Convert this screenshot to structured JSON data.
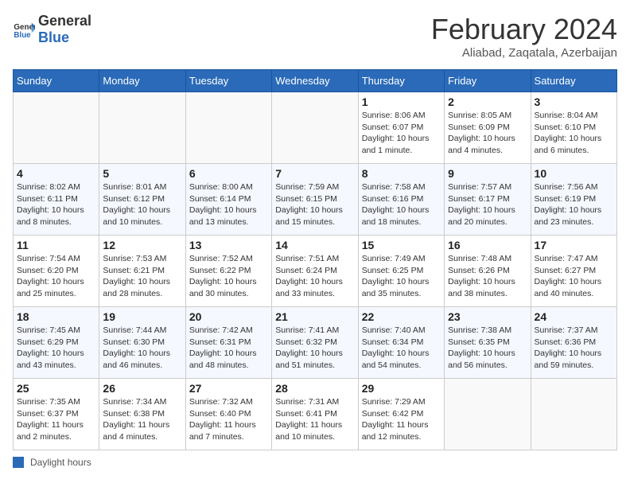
{
  "header": {
    "logo_general": "General",
    "logo_blue": "Blue",
    "month_year": "February 2024",
    "location": "Aliabad, Zaqatala, Azerbaijan"
  },
  "days_of_week": [
    "Sunday",
    "Monday",
    "Tuesday",
    "Wednesday",
    "Thursday",
    "Friday",
    "Saturday"
  ],
  "weeks": [
    [
      {
        "day": "",
        "info": ""
      },
      {
        "day": "",
        "info": ""
      },
      {
        "day": "",
        "info": ""
      },
      {
        "day": "",
        "info": ""
      },
      {
        "day": "1",
        "info": "Sunrise: 8:06 AM\nSunset: 6:07 PM\nDaylight: 10 hours and 1 minute."
      },
      {
        "day": "2",
        "info": "Sunrise: 8:05 AM\nSunset: 6:09 PM\nDaylight: 10 hours and 4 minutes."
      },
      {
        "day": "3",
        "info": "Sunrise: 8:04 AM\nSunset: 6:10 PM\nDaylight: 10 hours and 6 minutes."
      }
    ],
    [
      {
        "day": "4",
        "info": "Sunrise: 8:02 AM\nSunset: 6:11 PM\nDaylight: 10 hours and 8 minutes."
      },
      {
        "day": "5",
        "info": "Sunrise: 8:01 AM\nSunset: 6:12 PM\nDaylight: 10 hours and 10 minutes."
      },
      {
        "day": "6",
        "info": "Sunrise: 8:00 AM\nSunset: 6:14 PM\nDaylight: 10 hours and 13 minutes."
      },
      {
        "day": "7",
        "info": "Sunrise: 7:59 AM\nSunset: 6:15 PM\nDaylight: 10 hours and 15 minutes."
      },
      {
        "day": "8",
        "info": "Sunrise: 7:58 AM\nSunset: 6:16 PM\nDaylight: 10 hours and 18 minutes."
      },
      {
        "day": "9",
        "info": "Sunrise: 7:57 AM\nSunset: 6:17 PM\nDaylight: 10 hours and 20 minutes."
      },
      {
        "day": "10",
        "info": "Sunrise: 7:56 AM\nSunset: 6:19 PM\nDaylight: 10 hours and 23 minutes."
      }
    ],
    [
      {
        "day": "11",
        "info": "Sunrise: 7:54 AM\nSunset: 6:20 PM\nDaylight: 10 hours and 25 minutes."
      },
      {
        "day": "12",
        "info": "Sunrise: 7:53 AM\nSunset: 6:21 PM\nDaylight: 10 hours and 28 minutes."
      },
      {
        "day": "13",
        "info": "Sunrise: 7:52 AM\nSunset: 6:22 PM\nDaylight: 10 hours and 30 minutes."
      },
      {
        "day": "14",
        "info": "Sunrise: 7:51 AM\nSunset: 6:24 PM\nDaylight: 10 hours and 33 minutes."
      },
      {
        "day": "15",
        "info": "Sunrise: 7:49 AM\nSunset: 6:25 PM\nDaylight: 10 hours and 35 minutes."
      },
      {
        "day": "16",
        "info": "Sunrise: 7:48 AM\nSunset: 6:26 PM\nDaylight: 10 hours and 38 minutes."
      },
      {
        "day": "17",
        "info": "Sunrise: 7:47 AM\nSunset: 6:27 PM\nDaylight: 10 hours and 40 minutes."
      }
    ],
    [
      {
        "day": "18",
        "info": "Sunrise: 7:45 AM\nSunset: 6:29 PM\nDaylight: 10 hours and 43 minutes."
      },
      {
        "day": "19",
        "info": "Sunrise: 7:44 AM\nSunset: 6:30 PM\nDaylight: 10 hours and 46 minutes."
      },
      {
        "day": "20",
        "info": "Sunrise: 7:42 AM\nSunset: 6:31 PM\nDaylight: 10 hours and 48 minutes."
      },
      {
        "day": "21",
        "info": "Sunrise: 7:41 AM\nSunset: 6:32 PM\nDaylight: 10 hours and 51 minutes."
      },
      {
        "day": "22",
        "info": "Sunrise: 7:40 AM\nSunset: 6:34 PM\nDaylight: 10 hours and 54 minutes."
      },
      {
        "day": "23",
        "info": "Sunrise: 7:38 AM\nSunset: 6:35 PM\nDaylight: 10 hours and 56 minutes."
      },
      {
        "day": "24",
        "info": "Sunrise: 7:37 AM\nSunset: 6:36 PM\nDaylight: 10 hours and 59 minutes."
      }
    ],
    [
      {
        "day": "25",
        "info": "Sunrise: 7:35 AM\nSunset: 6:37 PM\nDaylight: 11 hours and 2 minutes."
      },
      {
        "day": "26",
        "info": "Sunrise: 7:34 AM\nSunset: 6:38 PM\nDaylight: 11 hours and 4 minutes."
      },
      {
        "day": "27",
        "info": "Sunrise: 7:32 AM\nSunset: 6:40 PM\nDaylight: 11 hours and 7 minutes."
      },
      {
        "day": "28",
        "info": "Sunrise: 7:31 AM\nSunset: 6:41 PM\nDaylight: 11 hours and 10 minutes."
      },
      {
        "day": "29",
        "info": "Sunrise: 7:29 AM\nSunset: 6:42 PM\nDaylight: 11 hours and 12 minutes."
      },
      {
        "day": "",
        "info": ""
      },
      {
        "day": "",
        "info": ""
      }
    ]
  ],
  "footer": {
    "legend_label": "Daylight hours"
  }
}
